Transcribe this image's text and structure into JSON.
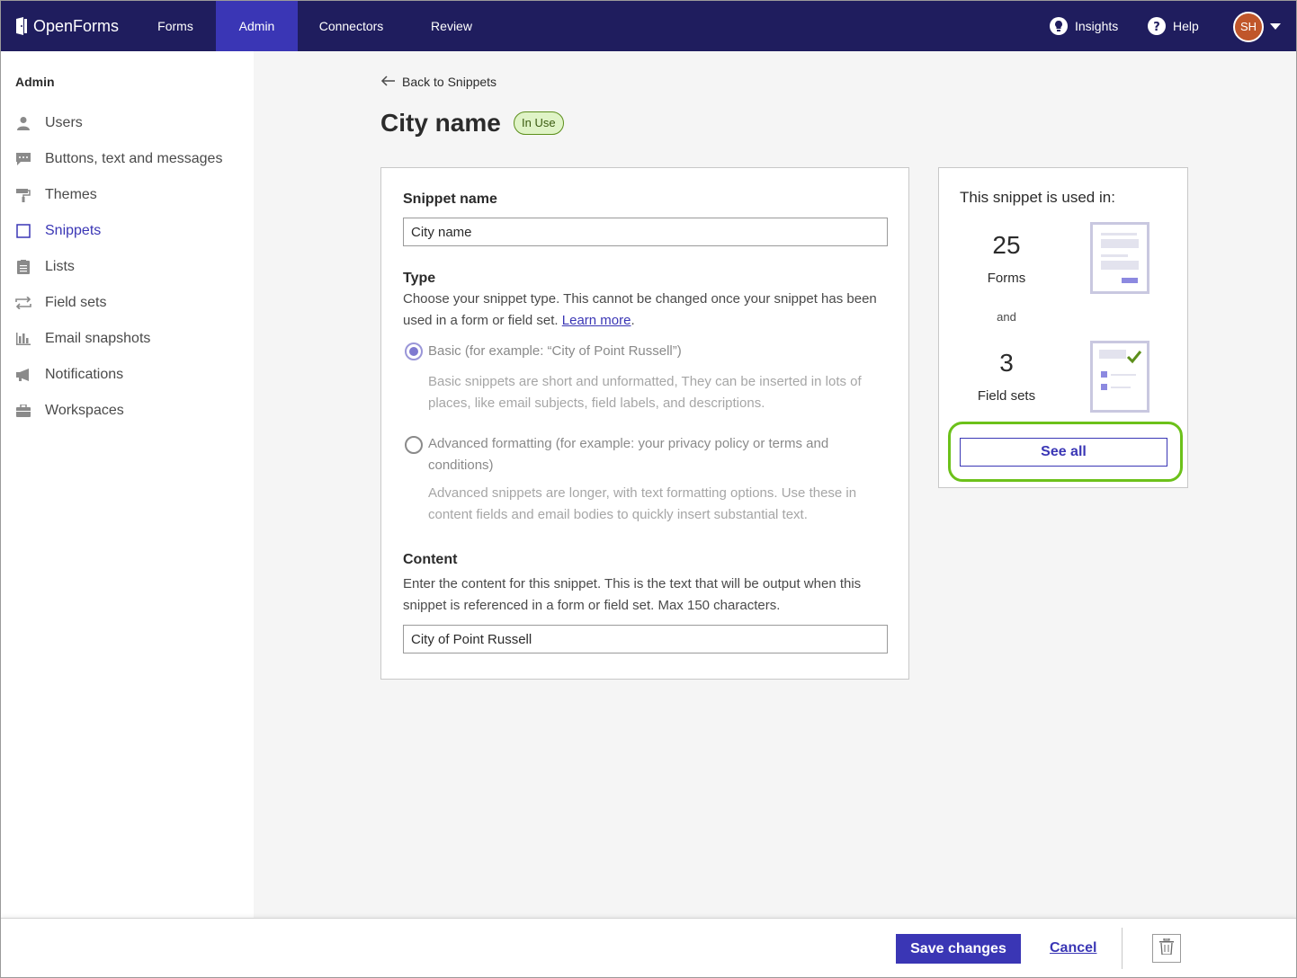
{
  "app": {
    "name": "OpenForms"
  },
  "topnav": {
    "items": [
      {
        "label": "Forms"
      },
      {
        "label": "Admin"
      },
      {
        "label": "Connectors"
      },
      {
        "label": "Review"
      }
    ],
    "active": "Admin",
    "insights_label": "Insights",
    "help_label": "Help",
    "avatar_initials": "SH"
  },
  "sidebar": {
    "title": "Admin",
    "items": [
      {
        "label": "Users",
        "icon": "user-icon"
      },
      {
        "label": "Buttons, text and messages",
        "icon": "speech-bubble-icon"
      },
      {
        "label": "Themes",
        "icon": "paint-roller-icon"
      },
      {
        "label": "Snippets",
        "icon": "square-icon"
      },
      {
        "label": "Lists",
        "icon": "clipboard-list-icon"
      },
      {
        "label": "Field sets",
        "icon": "repeat-arrows-icon"
      },
      {
        "label": "Email snapshots",
        "icon": "bar-chart-icon"
      },
      {
        "label": "Notifications",
        "icon": "megaphone-icon"
      },
      {
        "label": "Workspaces",
        "icon": "briefcase-icon"
      }
    ],
    "active": "Snippets"
  },
  "main": {
    "back_label": "Back to Snippets",
    "title": "City name",
    "status_badge": "In Use",
    "form": {
      "snippet_name_label": "Snippet name",
      "snippet_name_value": "City name",
      "type_label": "Type",
      "type_help": "Choose your snippet type. This cannot be changed once your snippet has been used in a form or field set.",
      "type_help_link": "Learn more",
      "type_help_suffix": ".",
      "options": [
        {
          "label": "Basic (for example: “City of Point Russell”)",
          "description": "Basic snippets are short and unformatted, They can be inserted in lots of places, like email subjects, field labels, and descriptions.",
          "selected": true
        },
        {
          "label": "Advanced formatting (for example: your privacy policy or terms and conditions)",
          "description": "Advanced snippets are longer, with text formatting options. Use these in content fields and email bodies to quickly insert substantial text.",
          "selected": false
        }
      ],
      "content_label": "Content",
      "content_help": "Enter the content for this snippet. This is the text that will be output when this snippet is referenced in a form or field set. Max 150 characters.",
      "content_value": "City of Point Russell"
    },
    "usage": {
      "title": "This snippet is used in:",
      "forms_count": "25",
      "forms_label": "Forms",
      "and_label": "and",
      "fieldsets_count": "3",
      "fieldsets_label": "Field sets",
      "see_all_label": "See all"
    }
  },
  "footer": {
    "save_label": "Save changes",
    "cancel_label": "Cancel",
    "delete_icon": "trash-icon"
  },
  "colors": {
    "nav_bg": "#1f1d5e",
    "accent": "#3a36b5",
    "badge_bg": "#dff3c6",
    "highlight_ring": "#6cc11a",
    "avatar_bg": "#c0562a"
  }
}
